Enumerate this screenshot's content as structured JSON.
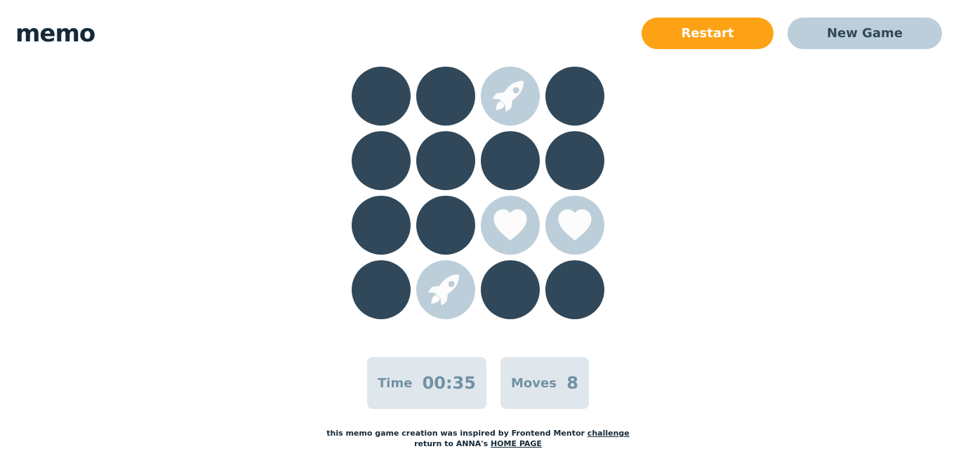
{
  "header": {
    "logo": "memo",
    "restart_label": "Restart",
    "new_game_label": "New Game"
  },
  "colors": {
    "accent": "#FDA214",
    "tile_hidden": "#304859",
    "tile_revealed": "#BCCED9",
    "icon": "#FCFCFC",
    "stat_bg": "#DFE7EC",
    "stat_text": "#7191A5"
  },
  "board": {
    "rows": 4,
    "cols": 4,
    "tiles": [
      {
        "state": "hidden"
      },
      {
        "state": "hidden"
      },
      {
        "state": "revealed",
        "icon": "rocket-icon"
      },
      {
        "state": "hidden"
      },
      {
        "state": "hidden"
      },
      {
        "state": "hidden"
      },
      {
        "state": "hidden"
      },
      {
        "state": "hidden"
      },
      {
        "state": "hidden"
      },
      {
        "state": "hidden"
      },
      {
        "state": "revealed",
        "icon": "heart-icon"
      },
      {
        "state": "revealed",
        "icon": "heart-icon"
      },
      {
        "state": "hidden"
      },
      {
        "state": "revealed",
        "icon": "rocket-icon"
      },
      {
        "state": "hidden"
      },
      {
        "state": "hidden"
      }
    ]
  },
  "stats": {
    "time_label": "Time",
    "time_value": "00:35",
    "moves_label": "Moves",
    "moves_value": "8"
  },
  "footer": {
    "line1_text": "this memo game creation was inspired by Frontend Mentor",
    "line1_link": "challenge",
    "line2_text": "return to ANNA's",
    "line2_link": "HOME PAGE"
  }
}
